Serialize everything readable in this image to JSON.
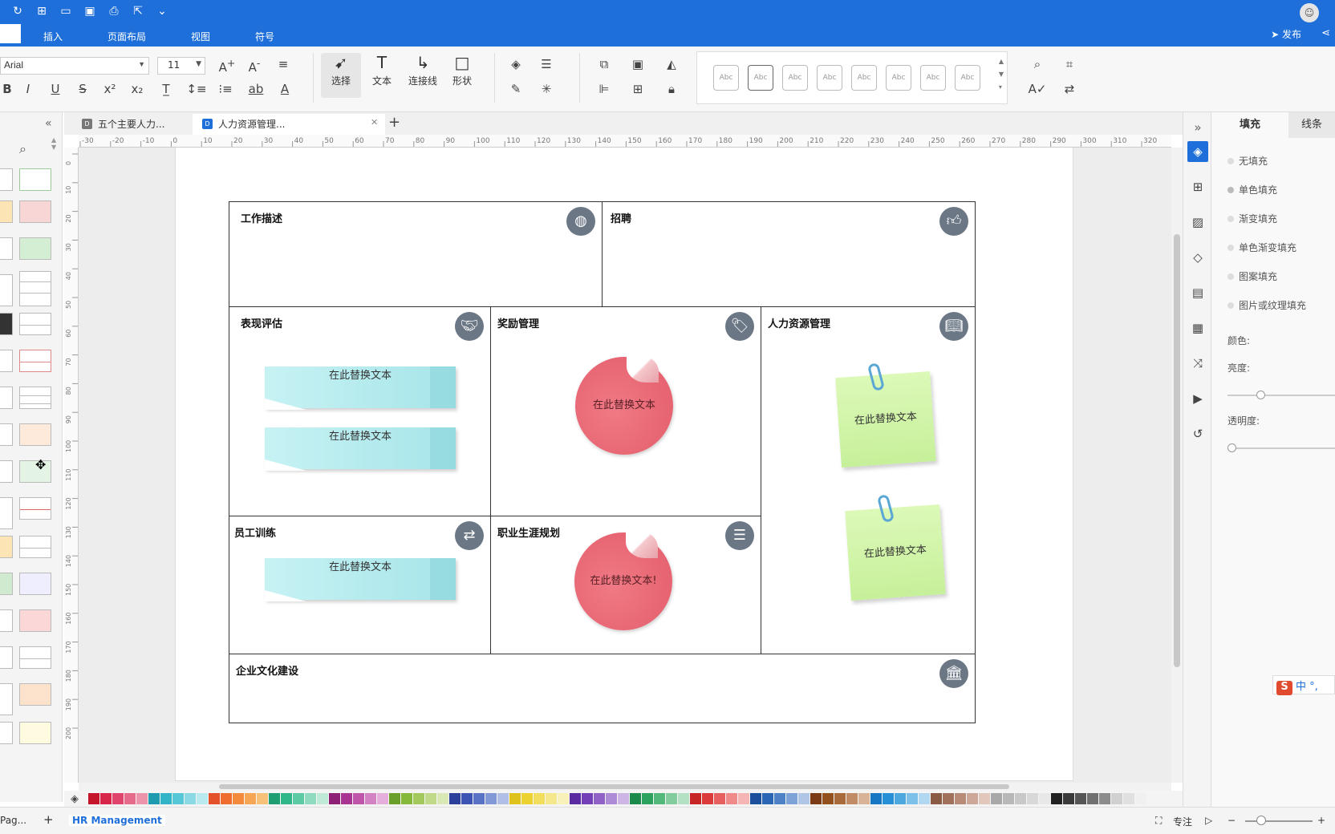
{
  "menu": {
    "items": [
      "插入",
      "页面布局",
      "视图",
      "符号"
    ],
    "publish": "发布"
  },
  "toolbar": {
    "font": "Arial",
    "size": "11",
    "tools": [
      {
        "label": "选择",
        "icon": "cursor-icon"
      },
      {
        "label": "文本",
        "icon": "text-icon"
      },
      {
        "label": "连接线",
        "icon": "connector-icon"
      },
      {
        "label": "形状",
        "icon": "shape-icon"
      }
    ],
    "style_labels": [
      "Abc",
      "Abc",
      "Abc",
      "Abc",
      "Abc",
      "Abc",
      "Abc",
      "Abc"
    ]
  },
  "tabs": [
    {
      "label": "五个主要人力..."
    },
    {
      "label": "人力资源管理..."
    }
  ],
  "diagram": {
    "cells": {
      "job": "工作描述",
      "recruit": "招聘",
      "perf": "表现评估",
      "reward": "奖励管理",
      "hrm": "人力资源管理",
      "train": "员工训练",
      "career": "职业生涯规划",
      "culture": "企业文化建设"
    },
    "placeholder": "在此替换文本",
    "placeholder_excl": "在此替换文本!"
  },
  "right_panel": {
    "tabs": [
      "填充",
      "线条"
    ],
    "options": [
      "无填充",
      "单色填充",
      "渐变填充",
      "单色渐变填充",
      "图案填充",
      "图片或纹理填充"
    ],
    "labels": {
      "color": "颜色:",
      "brightness": "亮度:",
      "transparency": "透明度:"
    }
  },
  "status": {
    "page": "Pag...",
    "name": "HR Management",
    "focus": "专注"
  },
  "ime": "中 °,",
  "colors": {
    "accent": "#1e6fd9"
  }
}
